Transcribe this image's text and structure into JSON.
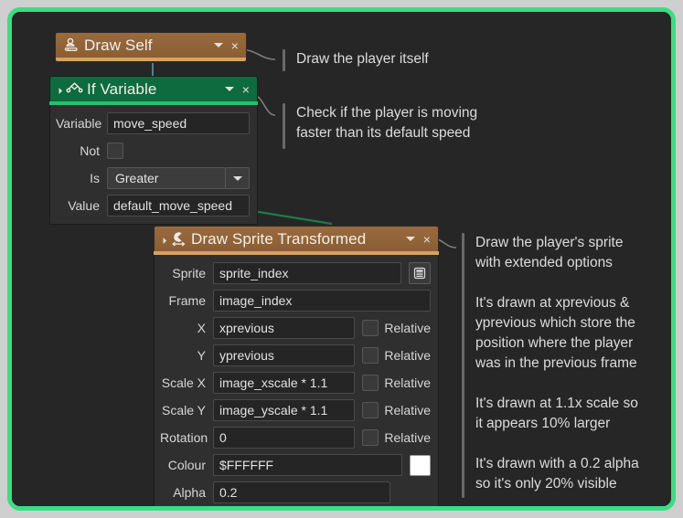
{
  "frame": {
    "accent_color": "#3ddc84",
    "background_color": "#262626"
  },
  "blocks": [
    {
      "id": "draw_self",
      "title": "Draw Self",
      "icon": "draw-self-icon",
      "header_color": "#8a5e35",
      "accent_color": "#d7a066",
      "collapse_icon": "collapse-triangle-icon",
      "dropdown_icon": "chevron-down-icon",
      "close_icon": "close-icon",
      "close_label": "×",
      "fields": []
    },
    {
      "id": "if_variable",
      "title": "If Variable",
      "icon": "if-variable-icon",
      "header_color": "#0d6b3f",
      "accent_color": "#27c06a",
      "collapse_icon": "collapse-triangle-icon",
      "dropdown_icon": "chevron-down-icon",
      "close_icon": "close-icon",
      "close_label": "×",
      "fields": [
        {
          "label": "Variable",
          "type": "text",
          "value": "move_speed"
        },
        {
          "label": "Not",
          "type": "checkbox",
          "checked": false
        },
        {
          "label": "Is",
          "type": "select",
          "value": "Greater"
        },
        {
          "label": "Value",
          "type": "text",
          "value": "default_move_speed"
        }
      ]
    },
    {
      "id": "draw_sprite_transformed",
      "title": "Draw Sprite Transformed",
      "icon": "draw-sprite-transformed-icon",
      "header_color": "#8a5e35",
      "accent_color": "#d7a066",
      "collapse_icon": "collapse-triangle-icon",
      "dropdown_icon": "chevron-down-icon",
      "close_icon": "close-icon",
      "close_label": "×",
      "relative_label": "Relative",
      "fields": [
        {
          "label": "Sprite",
          "type": "text",
          "value": "sprite_index",
          "menu_icon": "list-menu-icon"
        },
        {
          "label": "Frame",
          "type": "text",
          "value": "image_index"
        },
        {
          "label": "X",
          "type": "text",
          "value": "xprevious",
          "relative": true,
          "relative_checked": false
        },
        {
          "label": "Y",
          "type": "text",
          "value": "yprevious",
          "relative": true,
          "relative_checked": false
        },
        {
          "label": "Scale X",
          "type": "text",
          "value": "image_xscale * 1.1",
          "relative": true,
          "relative_checked": false
        },
        {
          "label": "Scale Y",
          "type": "text",
          "value": "image_yscale * 1.1",
          "relative": true,
          "relative_checked": false
        },
        {
          "label": "Rotation",
          "type": "text",
          "value": "0",
          "relative": true,
          "relative_checked": false
        },
        {
          "label": "Colour",
          "type": "text",
          "value": "$FFFFFF",
          "swatch": "#FFFFFF"
        },
        {
          "label": "Alpha",
          "type": "text",
          "value": "0.2"
        }
      ]
    }
  ],
  "annotations": [
    {
      "id": "ann_draw_self",
      "text": "Draw the player itself"
    },
    {
      "id": "ann_if_variable",
      "text": "Check if the player is moving\nfaster than its default speed"
    },
    {
      "id": "ann_draw_sprite",
      "text": "Draw the player's sprite\nwith extended options\n\nIt's drawn at xprevious &\nyprevious which store the\nposition where the player\nwas in the previous frame\n\nIt's drawn at 1.1x scale so\nit appears 10% larger\n\nIt's drawn with a 0.2 alpha\nso it's only 20% visible"
    }
  ]
}
